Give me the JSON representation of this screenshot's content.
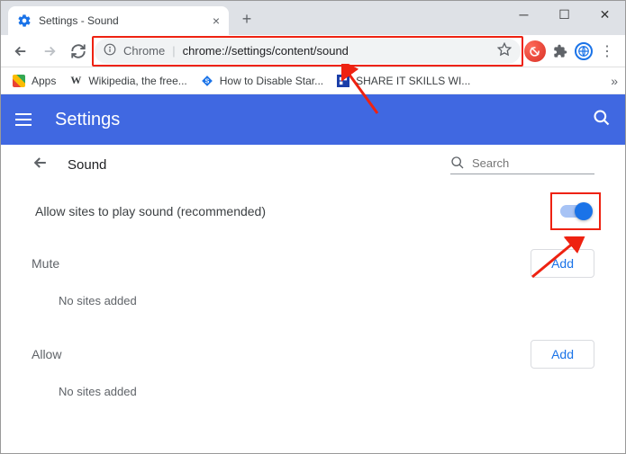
{
  "window": {
    "tab_title": "Settings - Sound"
  },
  "navbar": {
    "url_prefix": "Chrome",
    "url_path": "chrome://settings/content/sound"
  },
  "bookmarks": {
    "apps": "Apps",
    "wiki": "Wikipedia, the free...",
    "disable": "How to Disable Star...",
    "share": "SHARE IT SKILLS WI..."
  },
  "header": {
    "title": "Settings"
  },
  "page": {
    "subtitle": "Sound",
    "search_placeholder": "Search",
    "allow_label": "Allow sites to play sound (recommended)",
    "mute_section": "Mute",
    "allow_section": "Allow",
    "add_label": "Add",
    "no_sites": "No sites added"
  }
}
